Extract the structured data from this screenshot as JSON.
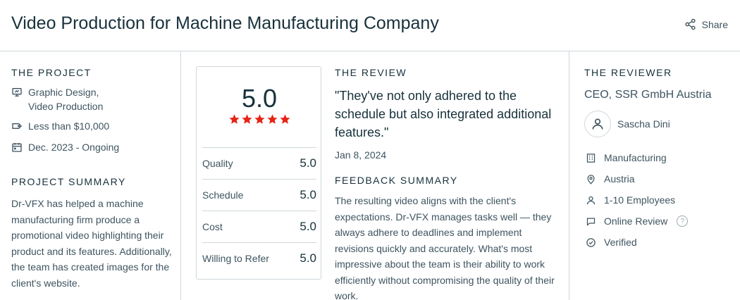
{
  "header": {
    "title": "Video Production for Machine Manufacturing Company",
    "share_label": "Share"
  },
  "project": {
    "section_title": "THE PROJECT",
    "services_line1": "Graphic Design,",
    "services_line2": "Video Production",
    "budget": "Less than $10,000",
    "dates": "Dec. 2023 - Ongoing",
    "summary_title": "PROJECT SUMMARY",
    "summary": "Dr-VFX has helped a machine manufacturing firm produce a promotional video highlighting their product and its features. Additionally, the team has created images for the client's website."
  },
  "rating": {
    "overall": "5.0",
    "stars": 5,
    "star_color": "#e62415",
    "rows": [
      {
        "label": "Quality",
        "score": "5.0"
      },
      {
        "label": "Schedule",
        "score": "5.0"
      },
      {
        "label": "Cost",
        "score": "5.0"
      },
      {
        "label": "Willing to Refer",
        "score": "5.0"
      }
    ]
  },
  "review": {
    "section_title": "THE REVIEW",
    "quote": "\"They've not only adhered to the schedule but also integrated additional features.\"",
    "date": "Jan 8, 2024",
    "feedback_title": "FEEDBACK SUMMARY",
    "feedback": "The resulting video aligns with the client's expectations. Dr-VFX manages tasks well — they always adhere to deadlines and implement revisions quickly and accurately. What's most impressive about the team is their ability to work efficiently without compromising the quality of their work."
  },
  "reviewer": {
    "section_title": "THE REVIEWER",
    "role": "CEO, SSR GmbH Austria",
    "name": "Sascha Dini",
    "industry": "Manufacturing",
    "location": "Austria",
    "employees": "1-10 Employees",
    "review_type": "Online Review",
    "help_symbol": "?",
    "status": "Verified"
  }
}
